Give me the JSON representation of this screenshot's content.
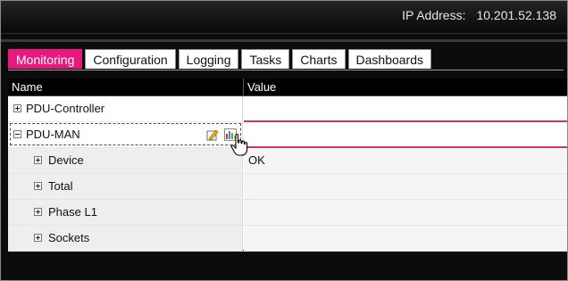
{
  "header": {
    "ip_label": "IP Address:",
    "ip_value": "10.201.52.138"
  },
  "tabs": [
    {
      "label": "Monitoring",
      "active": true
    },
    {
      "label": "Configuration",
      "active": false
    },
    {
      "label": "Logging",
      "active": false
    },
    {
      "label": "Tasks",
      "active": false
    },
    {
      "label": "Charts",
      "active": false
    },
    {
      "label": "Dashboards",
      "active": false
    }
  ],
  "grid": {
    "columns": {
      "name": "Name",
      "value": "Value"
    },
    "rows": [
      {
        "name": "PDU-Controller",
        "value": "",
        "expander": "plus-box-icon"
      },
      {
        "name": "PDU-MAN",
        "value": "",
        "expander": "minus-box-icon",
        "actions": [
          "edit-icon",
          "chart-icon"
        ]
      },
      {
        "name": "Device",
        "value": "OK",
        "expander": "plus-box-icon"
      },
      {
        "name": "Total",
        "value": "",
        "expander": "plus-box-icon"
      },
      {
        "name": "Phase L1",
        "value": "",
        "expander": "plus-box-icon"
      },
      {
        "name": "Sockets",
        "value": "",
        "expander": "plus-box-icon"
      }
    ]
  },
  "colors": {
    "accent": "#e8197e",
    "row_line": "#d2336e",
    "selection": "#3a4c86"
  }
}
